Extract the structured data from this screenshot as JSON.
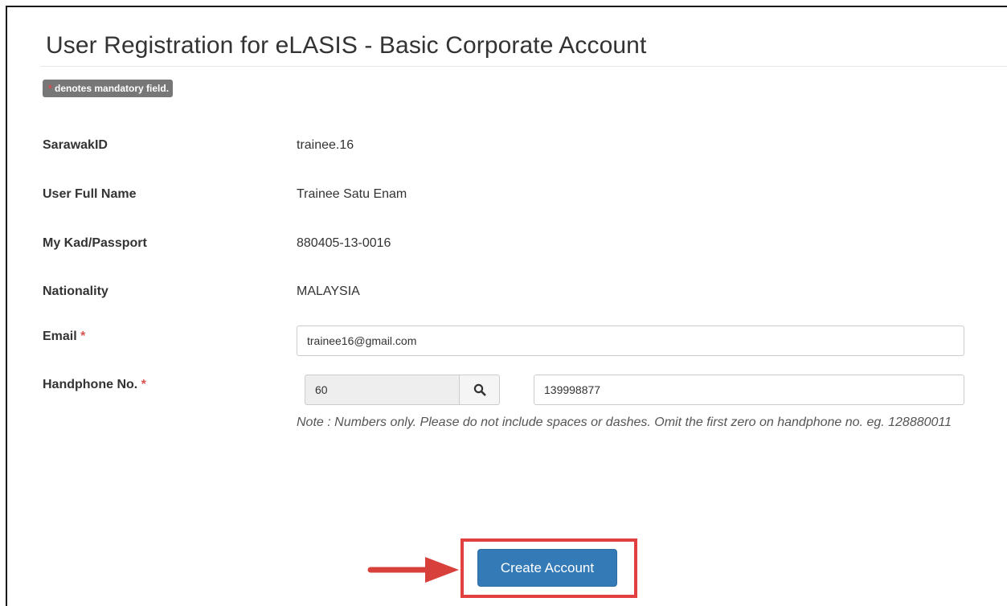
{
  "page": {
    "title": "User Registration for eLASIS - Basic Corporate Account",
    "mandatory_note": {
      "star": "*",
      "text": " denotes mandatory field."
    }
  },
  "fields": [
    {
      "label": "SarawakID",
      "value": "trainee.16"
    },
    {
      "label": "User Full Name",
      "value": "Trainee Satu Enam"
    },
    {
      "label": "My Kad/Passport",
      "value": "880405-13-0016"
    },
    {
      "label": "Nationality",
      "value": "MALAYSIA"
    }
  ],
  "email": {
    "label": "Email",
    "required_marker": " *",
    "value": "trainee16@gmail.com"
  },
  "handphone": {
    "label": "Handphone No.",
    "required_marker": " *",
    "country_code": "60",
    "number": "139998877",
    "search_icon": "search-icon",
    "note": "Note : Numbers only. Please do not include spaces or dashes. Omit the first zero on handphone no. eg. 128880011"
  },
  "actions": {
    "create_account_label": "Create Account"
  },
  "colors": {
    "primary": "#337ab7",
    "required": "#d9534f",
    "highlight": "#e2403e",
    "badge": "#777777"
  }
}
